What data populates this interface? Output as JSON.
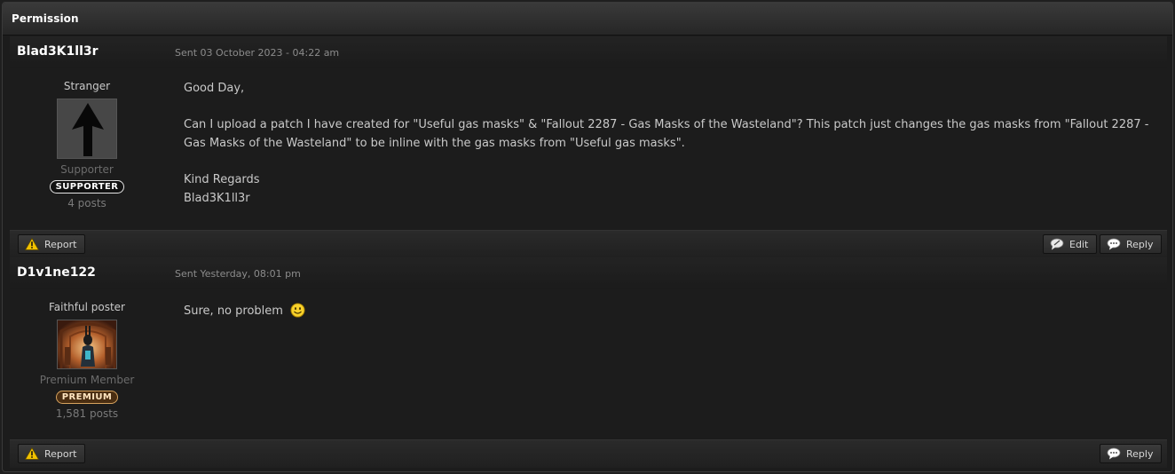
{
  "panel": {
    "title": "Permission"
  },
  "posts": [
    {
      "author": "Blad3K1ll3r",
      "sent": "Sent 03 October 2023 - 04:22 am",
      "rank_title": "Stranger",
      "member_group": "Supporter",
      "badge": "SUPPORTER",
      "post_count": "4 posts",
      "avatar_icon": "up-arrow-icon",
      "paragraphs": [
        "Good Day,",
        "Can I upload a patch I have created for \"Useful gas masks\" & \"Fallout 2287 - Gas Masks of the Wasteland\"? This patch just changes the gas masks from \"Fallout 2287 - Gas Masks of the Wasteland\" to be inline with the gas masks from \"Useful gas masks\".",
        "Kind Regards",
        "Blad3K1ll3r"
      ],
      "buttons": {
        "report": "Report",
        "edit": "Edit",
        "reply": "Reply"
      }
    },
    {
      "author": "D1v1ne122",
      "sent": "Sent Yesterday, 08:01 pm",
      "rank_title": "Faithful poster",
      "member_group": "Premium Member",
      "badge": "PREMIUM",
      "post_count": "1,581 posts",
      "avatar_icon": "wasteland-character-avatar",
      "paragraphs": [
        "Sure, no problem"
      ],
      "emoticon": "smiley-icon",
      "buttons": {
        "report": "Report",
        "reply": "Reply"
      }
    }
  ],
  "colors": {
    "background": "#1c1c1c",
    "text": "#c9c9c9",
    "premium": "#d6a25e",
    "warning": "#f2c200"
  }
}
